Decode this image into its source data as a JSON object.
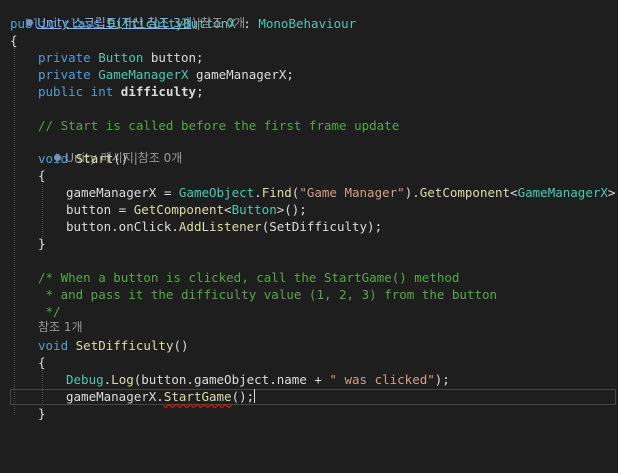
{
  "codelens": {
    "class": {
      "link": "Unity 스크립트(자산 참조 3개)",
      "sep": "|",
      "refs": "참조 0개"
    },
    "start": {
      "unity": "Unity 메시지",
      "sep": "|",
      "refs": "참조 0개"
    },
    "set_difficulty": {
      "refs": "참조 1개"
    }
  },
  "code": {
    "class_decl": {
      "kw": "public class ",
      "name": "DifficultyButtonX",
      "colon": " : ",
      "base": "MonoBehaviour"
    },
    "open_brace": "{",
    "close_brace": "}",
    "field_button": {
      "kw": "private ",
      "type": "Button",
      "name": " button;"
    },
    "field_gm": {
      "kw": "private ",
      "type": "GameManagerX",
      "name": " gameManagerX;"
    },
    "field_difficulty": {
      "kw": "public int ",
      "name": "difficulty",
      "end": ";"
    },
    "comment_start": "// Start is called before the first frame update",
    "start_decl": {
      "kw": "void ",
      "name": "Start",
      "parens": "()"
    },
    "start_line1": {
      "a": "gameManagerX = ",
      "type1": "GameObject",
      "dot": ".",
      "find": "Find",
      "lp": "(",
      "str": "\"Game Manager\"",
      "rp": ").",
      "getc": "GetComponent",
      "lt": "<",
      "type2": "GameManagerX",
      "end": ">();"
    },
    "start_line2": {
      "a": "button = ",
      "getc": "GetComponent",
      "lt": "<",
      "type": "Button",
      "end": ">();"
    },
    "start_line3": {
      "a": "button.onClick.",
      "method": "AddListener",
      "end": "(SetDifficulty);"
    },
    "block_comment1": "/* When a button is clicked, call the StartGame() method",
    "block_comment2": " * and pass it the difficulty value (1, 2, 3) from the button",
    "block_comment3": " */",
    "setdiff_decl": {
      "kw": "void ",
      "name": "SetDifficulty",
      "parens": "()"
    },
    "debug_line": {
      "type": "Debug",
      "dot": ".",
      "method": "Log",
      "a": "(button.gameObject.name + ",
      "str": "\" was clicked\"",
      "end": ");"
    },
    "startgame_line": {
      "a": "gameManagerX.",
      "method": "StartGame",
      "end": "();"
    }
  }
}
